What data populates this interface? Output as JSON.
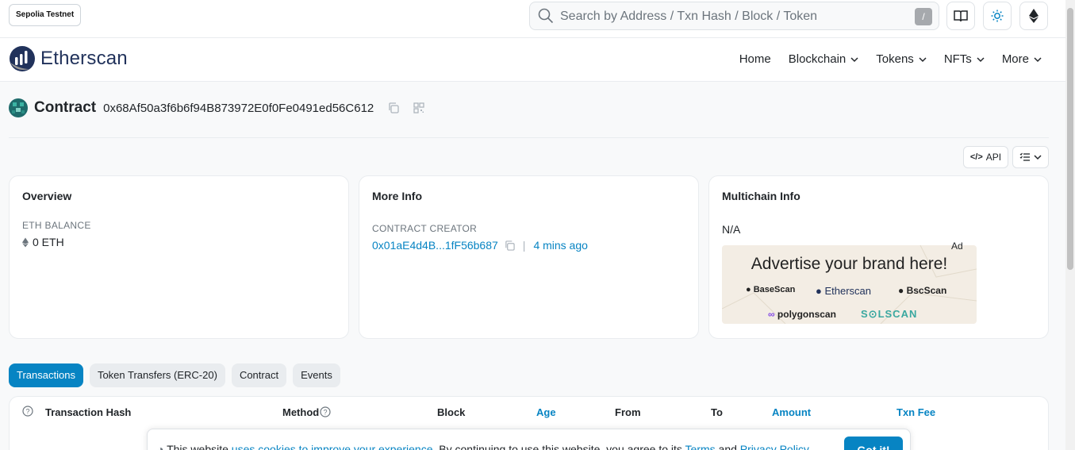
{
  "topbar": {
    "network_badge": "Sepolia Testnet",
    "search_placeholder": "Search by Address / Txn Hash / Block / Token",
    "search_shortcut": "/"
  },
  "navbar": {
    "brand": "Etherscan",
    "items": [
      {
        "label": "Home"
      },
      {
        "label": "Blockchain"
      },
      {
        "label": "Tokens"
      },
      {
        "label": "NFTs"
      },
      {
        "label": "More"
      }
    ]
  },
  "contract": {
    "title": "Contract",
    "address": "0x68Af50a3f6b6f94B873972E0f0Fe0491ed56C612"
  },
  "toolbar": {
    "api_label": "API"
  },
  "overview": {
    "title": "Overview",
    "balance_label": "ETH BALANCE",
    "balance_value": "0 ETH"
  },
  "more_info": {
    "title": "More Info",
    "creator_label": "CONTRACT CREATOR",
    "creator_address": "0x01aE4d4B...1fF56b687",
    "separator": "|",
    "age": "4 mins ago"
  },
  "multichain": {
    "title": "Multichain Info",
    "value": "N/A",
    "ad_badge": "Ad",
    "ad_headline": "Advertise your brand here!",
    "ad_brands": [
      "BaseScan",
      "Etherscan",
      "BscScan",
      "polygonscan",
      "S⊙LSCAN"
    ]
  },
  "tabs": [
    {
      "label": "Transactions",
      "active": true
    },
    {
      "label": "Token Transfers (ERC-20)",
      "active": false
    },
    {
      "label": "Contract",
      "active": false
    },
    {
      "label": "Events",
      "active": false
    }
  ],
  "table": {
    "headers": [
      "Transaction Hash",
      "Method",
      "Block",
      "Age",
      "From",
      "To",
      "Amount",
      "Txn Fee"
    ]
  },
  "cookie": {
    "text_before": "This website ",
    "link1": "uses cookies to improve your experience",
    "text_middle": ". By continuing to use this website, you agree to its ",
    "link2": "Terms",
    "text_and": " and ",
    "link3": "Privacy Policy",
    "button": "Got it!"
  },
  "colors": {
    "accent": "#0784c3",
    "brand_dark": "#21325b"
  }
}
